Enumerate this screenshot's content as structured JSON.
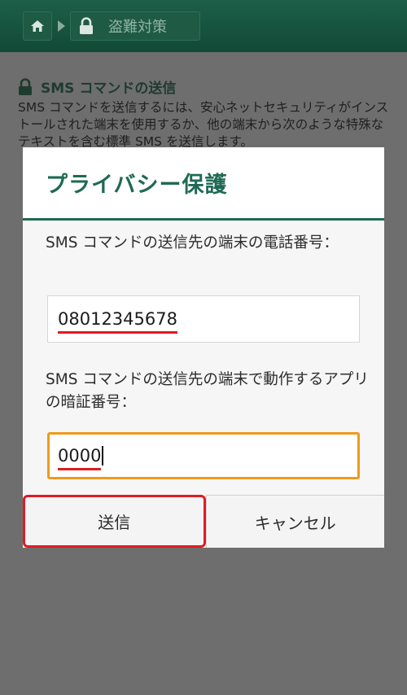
{
  "header": {
    "title": "盗難対策"
  },
  "background": {
    "heading": "SMS コマンドの送信",
    "text": "SMS コマンドを送信するには、安心ネットセキュリティがインストールされた端末を使用するか、他の端末から次のような特殊なテキストを含む標準 SMS を送信します。"
  },
  "dialog": {
    "title": "プライバシー保護",
    "phone_label": "SMS コマンドの送信先の端末の電話番号：",
    "phone_value": "08012345678",
    "pin_label": "SMS コマンドの送信先の端末で動作するアプリの暗証番号：",
    "pin_value": "0000",
    "send_label": "送信",
    "cancel_label": "キャンセル"
  },
  "colors": {
    "brand": "#1f6a52",
    "focus": "#ef9a1c",
    "highlight": "#e11b22"
  }
}
